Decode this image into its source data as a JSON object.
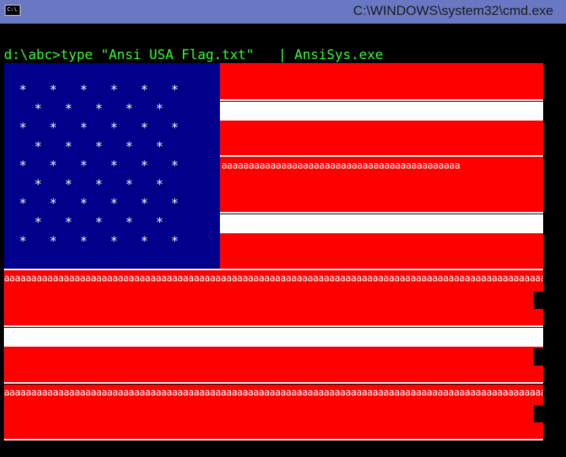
{
  "window": {
    "title": "C:\\WINDOWS\\system32\\cmd.exe",
    "icon": "cmd-icon",
    "icon_text": "C:\\"
  },
  "console": {
    "command_line": "d:\\abc>type \"Ansi USA Flag.txt\"   | AnsiSys.exe",
    "prompt_color": "#33ff33"
  },
  "flag": {
    "star_rows": [
      "  *   *   *   *   *   *",
      "    *   *   *   *   *",
      "  *   *   *   *   *   *",
      "    *   *   *   *   *",
      "  *   *   *   *   *   *",
      "    *   *   *   *   *",
      "  *   *   *   *   *   *",
      "    *   *   *   *   *",
      "  *   *   *   *   *   *"
    ],
    "a_row_short": "aaaaaaaaaaaaaaaaaaaaaaaaaaaaaaaaaaaaaaaaaaaa",
    "a_row_full": "aaaaaaaaaaaaaaaaaaaaaaaaaaaaaaaaaaaaaaaaaaaaaaaaaaaaaaaaaaaaaaaaaaaaaaaaaaaaaaaaaaaaaaaaaaaaaaaaaaaaaaaaaaaaaaaaaaa",
    "colors": {
      "red": "#ff0000",
      "white": "#ffffff",
      "blue": "#00008b"
    }
  }
}
